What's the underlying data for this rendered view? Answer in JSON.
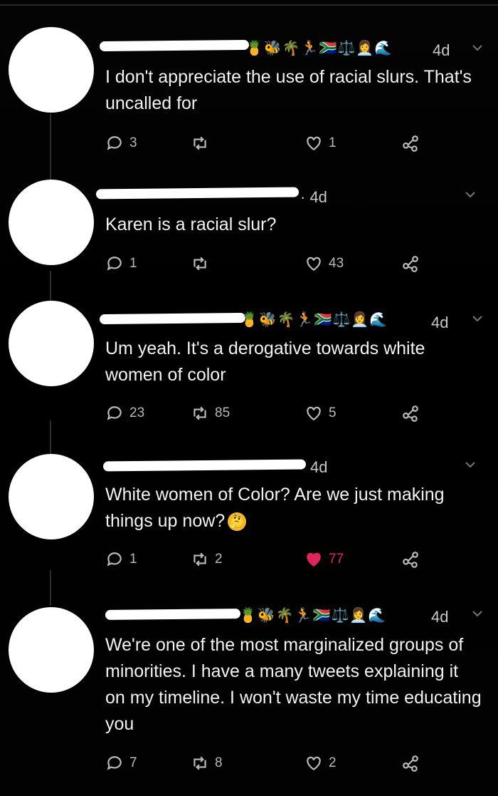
{
  "tweets": [
    {
      "name_emojis": "🍍🐝🌴🏃🇿🇦⚖️👩‍💼🌊",
      "time": "4d",
      "text": "I don't appreciate the use of racial slurs. That's uncalled for",
      "reply_count": "3",
      "retweet_count": "",
      "like_count": "1",
      "liked": false
    },
    {
      "name_emojis": "",
      "time": "· 4d",
      "text": "Karen is a racial slur?",
      "reply_count": "1",
      "retweet_count": "",
      "like_count": "43",
      "liked": false
    },
    {
      "name_emojis": "🍍🐝🌴🏃🇿🇦⚖️👩‍💼🌊",
      "time": "4d",
      "text": "Um yeah. It's a derogative towards white women of color",
      "reply_count": "23",
      "retweet_count": "85",
      "like_count": "5",
      "liked": false
    },
    {
      "name_emojis": "",
      "time": "4d",
      "text": "White women of Color? Are we just making things up now?",
      "text_emoji": "🤔",
      "reply_count": "1",
      "retweet_count": "2",
      "like_count": "77",
      "liked": true
    },
    {
      "name_emojis": "🍍🐝🌴🏃🇿🇦⚖️👩‍💼🌊",
      "time": "4d",
      "text": "We're one of the most marginalized groups of minorities. I have a many tweets explaining it on my timeline. I won't waste my time educating you",
      "reply_count": "7",
      "retweet_count": "8",
      "like_count": "2",
      "liked": false
    }
  ],
  "colors": {
    "background": "#000000",
    "text": "#f2f2f2",
    "muted": "#b8b8b8",
    "like_active": "#e0245e",
    "redaction": "#ffffff"
  },
  "icons": {
    "reply": "reply-icon",
    "retweet": "retweet-icon",
    "like": "heart-icon",
    "share": "share-icon",
    "menu": "chevron-down-icon"
  }
}
